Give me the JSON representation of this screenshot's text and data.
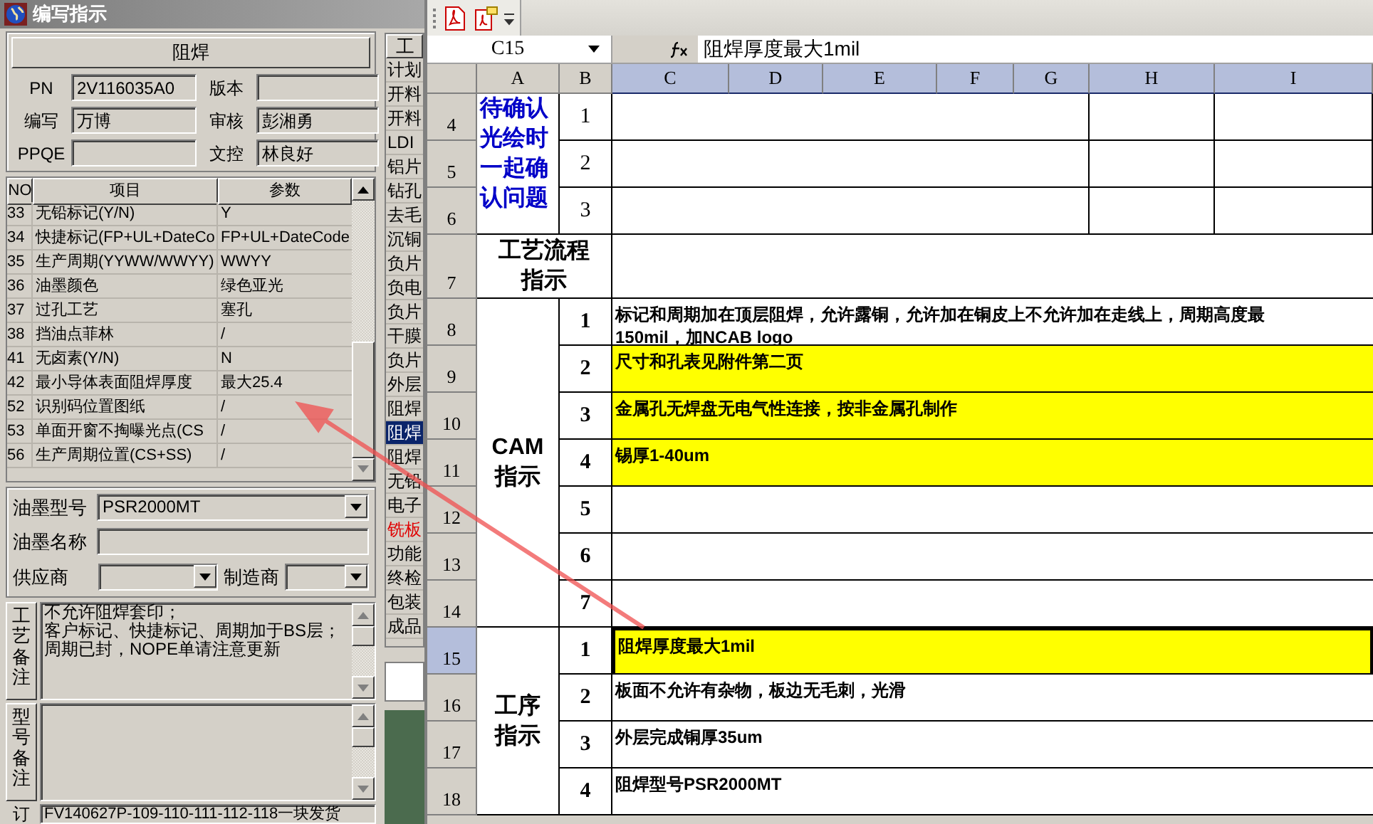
{
  "left_window": {
    "title": "编写指示",
    "section_title": "阻焊",
    "fields": [
      {
        "label": "PN",
        "value": "2V116035A0"
      },
      {
        "label": "版本"
      },
      {
        "label": "编写",
        "value": "万博"
      },
      {
        "label": "审核",
        "value": "彭湘勇"
      },
      {
        "label": "PPQE"
      },
      {
        "label": "文控",
        "value": "林良好"
      }
    ],
    "params_table": {
      "columns": [
        "NO",
        "项目",
        "参数"
      ],
      "rows": [
        {
          "no": "33",
          "item": "无铅标记(Y/N)",
          "param": "Y"
        },
        {
          "no": "34",
          "item": "快捷标记(FP+UL+DateCo",
          "param": "FP+UL+DateCode"
        },
        {
          "no": "35",
          "item": "生产周期(YYWW/WWYY)",
          "param": "WWYY"
        },
        {
          "no": "36",
          "item": "油墨颜色",
          "param": "绿色亚光"
        },
        {
          "no": "37",
          "item": "过孔工艺",
          "param": "塞孔"
        },
        {
          "no": "38",
          "item": "挡油点菲林",
          "param": "/"
        },
        {
          "no": "41",
          "item": "无卤素(Y/N)",
          "param": "N"
        },
        {
          "no": "42",
          "item": "最小导体表面阻焊厚度",
          "param": "最大25.4"
        },
        {
          "no": "52",
          "item": "识别码位置图纸",
          "param": "/"
        },
        {
          "no": "53",
          "item": "单面开窗不掏曝光点(CS",
          "param": "/"
        },
        {
          "no": "56",
          "item": "生产周期位置(CS+SS)",
          "param": "/"
        }
      ]
    },
    "ink_fields": [
      {
        "label": "油墨型号",
        "kind": "combo",
        "value": "PSR2000MT"
      },
      {
        "label": "油墨名称",
        "kind": "text"
      },
      {
        "label": "供应商",
        "kind": "combo"
      },
      {
        "label": "制造商",
        "kind": "combo"
      }
    ],
    "remarks": [
      {
        "label": "工艺备注",
        "lines": [
          "不允许阻焊套印；",
          "客户标记、快捷标记、周期加于BS层；",
          "周期已封，NOPE单请注意更新"
        ]
      },
      {
        "label": "型号备注"
      }
    ],
    "order": {
      "label": "订",
      "value": "FV140627P-109-110-111-112-118一块发货"
    }
  },
  "process_steps": {
    "header": "工",
    "items": [
      {
        "label": "计划",
        "selected": false
      },
      {
        "label": "开料",
        "selected": false
      },
      {
        "label": "开料",
        "selected": false
      },
      {
        "label": "LDI",
        "selected": false
      },
      {
        "label": "铝片",
        "selected": false
      },
      {
        "label": "钻孔",
        "selected": false
      },
      {
        "label": "去毛",
        "selected": false
      },
      {
        "label": "沉铜",
        "selected": false
      },
      {
        "label": "负片",
        "selected": false
      },
      {
        "label": "负电",
        "selected": false
      },
      {
        "label": "负片",
        "selected": false
      },
      {
        "label": "干膜",
        "selected": false
      },
      {
        "label": "负片",
        "selected": false
      },
      {
        "label": "外层",
        "selected": false
      },
      {
        "label": "阻焊",
        "selected": false
      },
      {
        "label": "阻焊",
        "selected": true
      },
      {
        "label": "阻焊",
        "selected": false
      },
      {
        "label": "无铅",
        "selected": false
      },
      {
        "label": "电子",
        "selected": false
      },
      {
        "label": "铣板",
        "selected": false,
        "color": "#e00000"
      },
      {
        "label": "功能",
        "selected": false
      },
      {
        "label": "终检",
        "selected": false
      },
      {
        "label": "包装",
        "selected": false
      },
      {
        "label": "成品",
        "selected": false
      }
    ]
  },
  "spreadsheet": {
    "name_box": "C15",
    "formula": "阻焊厚度最大1mil",
    "columns": [
      {
        "label": "A",
        "selected": false
      },
      {
        "label": "B",
        "selected": false
      },
      {
        "label": "C",
        "selected": true
      },
      {
        "label": "D",
        "selected": true
      },
      {
        "label": "E",
        "selected": true
      },
      {
        "label": "F",
        "selected": true
      },
      {
        "label": "G",
        "selected": true
      },
      {
        "label": "H",
        "selected": true
      },
      {
        "label": "I",
        "selected": true
      }
    ],
    "row_headers": [
      {
        "label": "4",
        "selected": false
      },
      {
        "label": "5",
        "selected": false
      },
      {
        "label": "6",
        "selected": false
      },
      {
        "label": "7",
        "selected": false
      },
      {
        "label": "8",
        "selected": false
      },
      {
        "label": "9",
        "selected": false
      },
      {
        "label": "10",
        "selected": false
      },
      {
        "label": "11",
        "selected": false
      },
      {
        "label": "12",
        "selected": false
      },
      {
        "label": "13",
        "selected": false
      },
      {
        "label": "14",
        "selected": false
      },
      {
        "label": "15",
        "selected": true
      },
      {
        "label": "16",
        "selected": false
      },
      {
        "label": "17",
        "selected": false
      },
      {
        "label": "18",
        "selected": false
      }
    ],
    "sections": [
      {
        "kind": "questions",
        "label": "待确认光绘时一起确认问题",
        "items": [
          {
            "number": "1"
          },
          {
            "number": "2"
          },
          {
            "number": "3"
          }
        ]
      },
      {
        "kind": "heading",
        "label": "工艺流程指示"
      },
      {
        "kind": "numbered",
        "label": "CAM指示",
        "items": [
          {
            "number": "1",
            "text": "标记和周期加在顶层阻焊，允许露铜，允许加在铜皮上不允许加在走线上，周期高度最\n150mil，加NCAB logo",
            "highlight": false,
            "selected": false
          },
          {
            "number": "2",
            "text": "尺寸和孔表见附件第二页",
            "highlight": true,
            "selected": false
          },
          {
            "number": "3",
            "text": "金属孔无焊盘无电气性连接，按非金属孔制作",
            "highlight": true,
            "selected": false
          },
          {
            "number": "4",
            "text": "锡厚1-40um",
            "highlight": true,
            "selected": false
          },
          {
            "number": "5",
            "highlight": false,
            "selected": false
          },
          {
            "number": "6",
            "highlight": false,
            "selected": false
          },
          {
            "number": "7",
            "highlight": false,
            "selected": false
          }
        ]
      },
      {
        "kind": "numbered",
        "label": "工序指示",
        "items": [
          {
            "number": "1",
            "text": "阻焊厚度最大1mil",
            "highlight": true,
            "selected": true
          },
          {
            "number": "2",
            "text": "板面不允许有杂物，板边无毛刺，光滑",
            "highlight": false,
            "selected": false
          },
          {
            "number": "3",
            "text": "外层完成铜厚35um",
            "highlight": false,
            "selected": false
          },
          {
            "number": "4",
            "text": "阻焊型号PSR2000MT",
            "highlight": false,
            "selected": false
          }
        ]
      }
    ]
  }
}
